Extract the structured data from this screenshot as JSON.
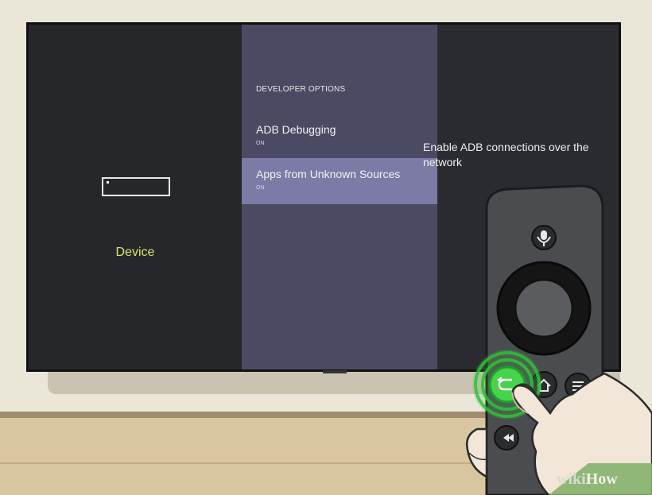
{
  "screen": {
    "left_panel": {
      "device_label": "Device"
    },
    "middle_panel": {
      "section_title": "DEVELOPER OPTIONS",
      "items": [
        {
          "label": "ADB Debugging",
          "status": "ON",
          "selected": false
        },
        {
          "label": "Apps from Unknown Sources",
          "status": "ON",
          "selected": true
        }
      ]
    },
    "right_panel": {
      "description": "Enable ADB connections over the network"
    }
  },
  "remote": {
    "buttons": [
      "microphone-icon",
      "navigation-ring",
      "back-icon",
      "home-icon",
      "menu-icon",
      "rewind-icon"
    ],
    "highlighted_button": "back-icon",
    "highlight_color": "#3ec43e"
  },
  "watermark": {
    "prefix": "wiki",
    "suffix": "How"
  },
  "colors": {
    "selected_item_bg": "#7b7ba6",
    "device_label": "#d8e36a",
    "middle_panel_bg": "#4b4a63"
  }
}
